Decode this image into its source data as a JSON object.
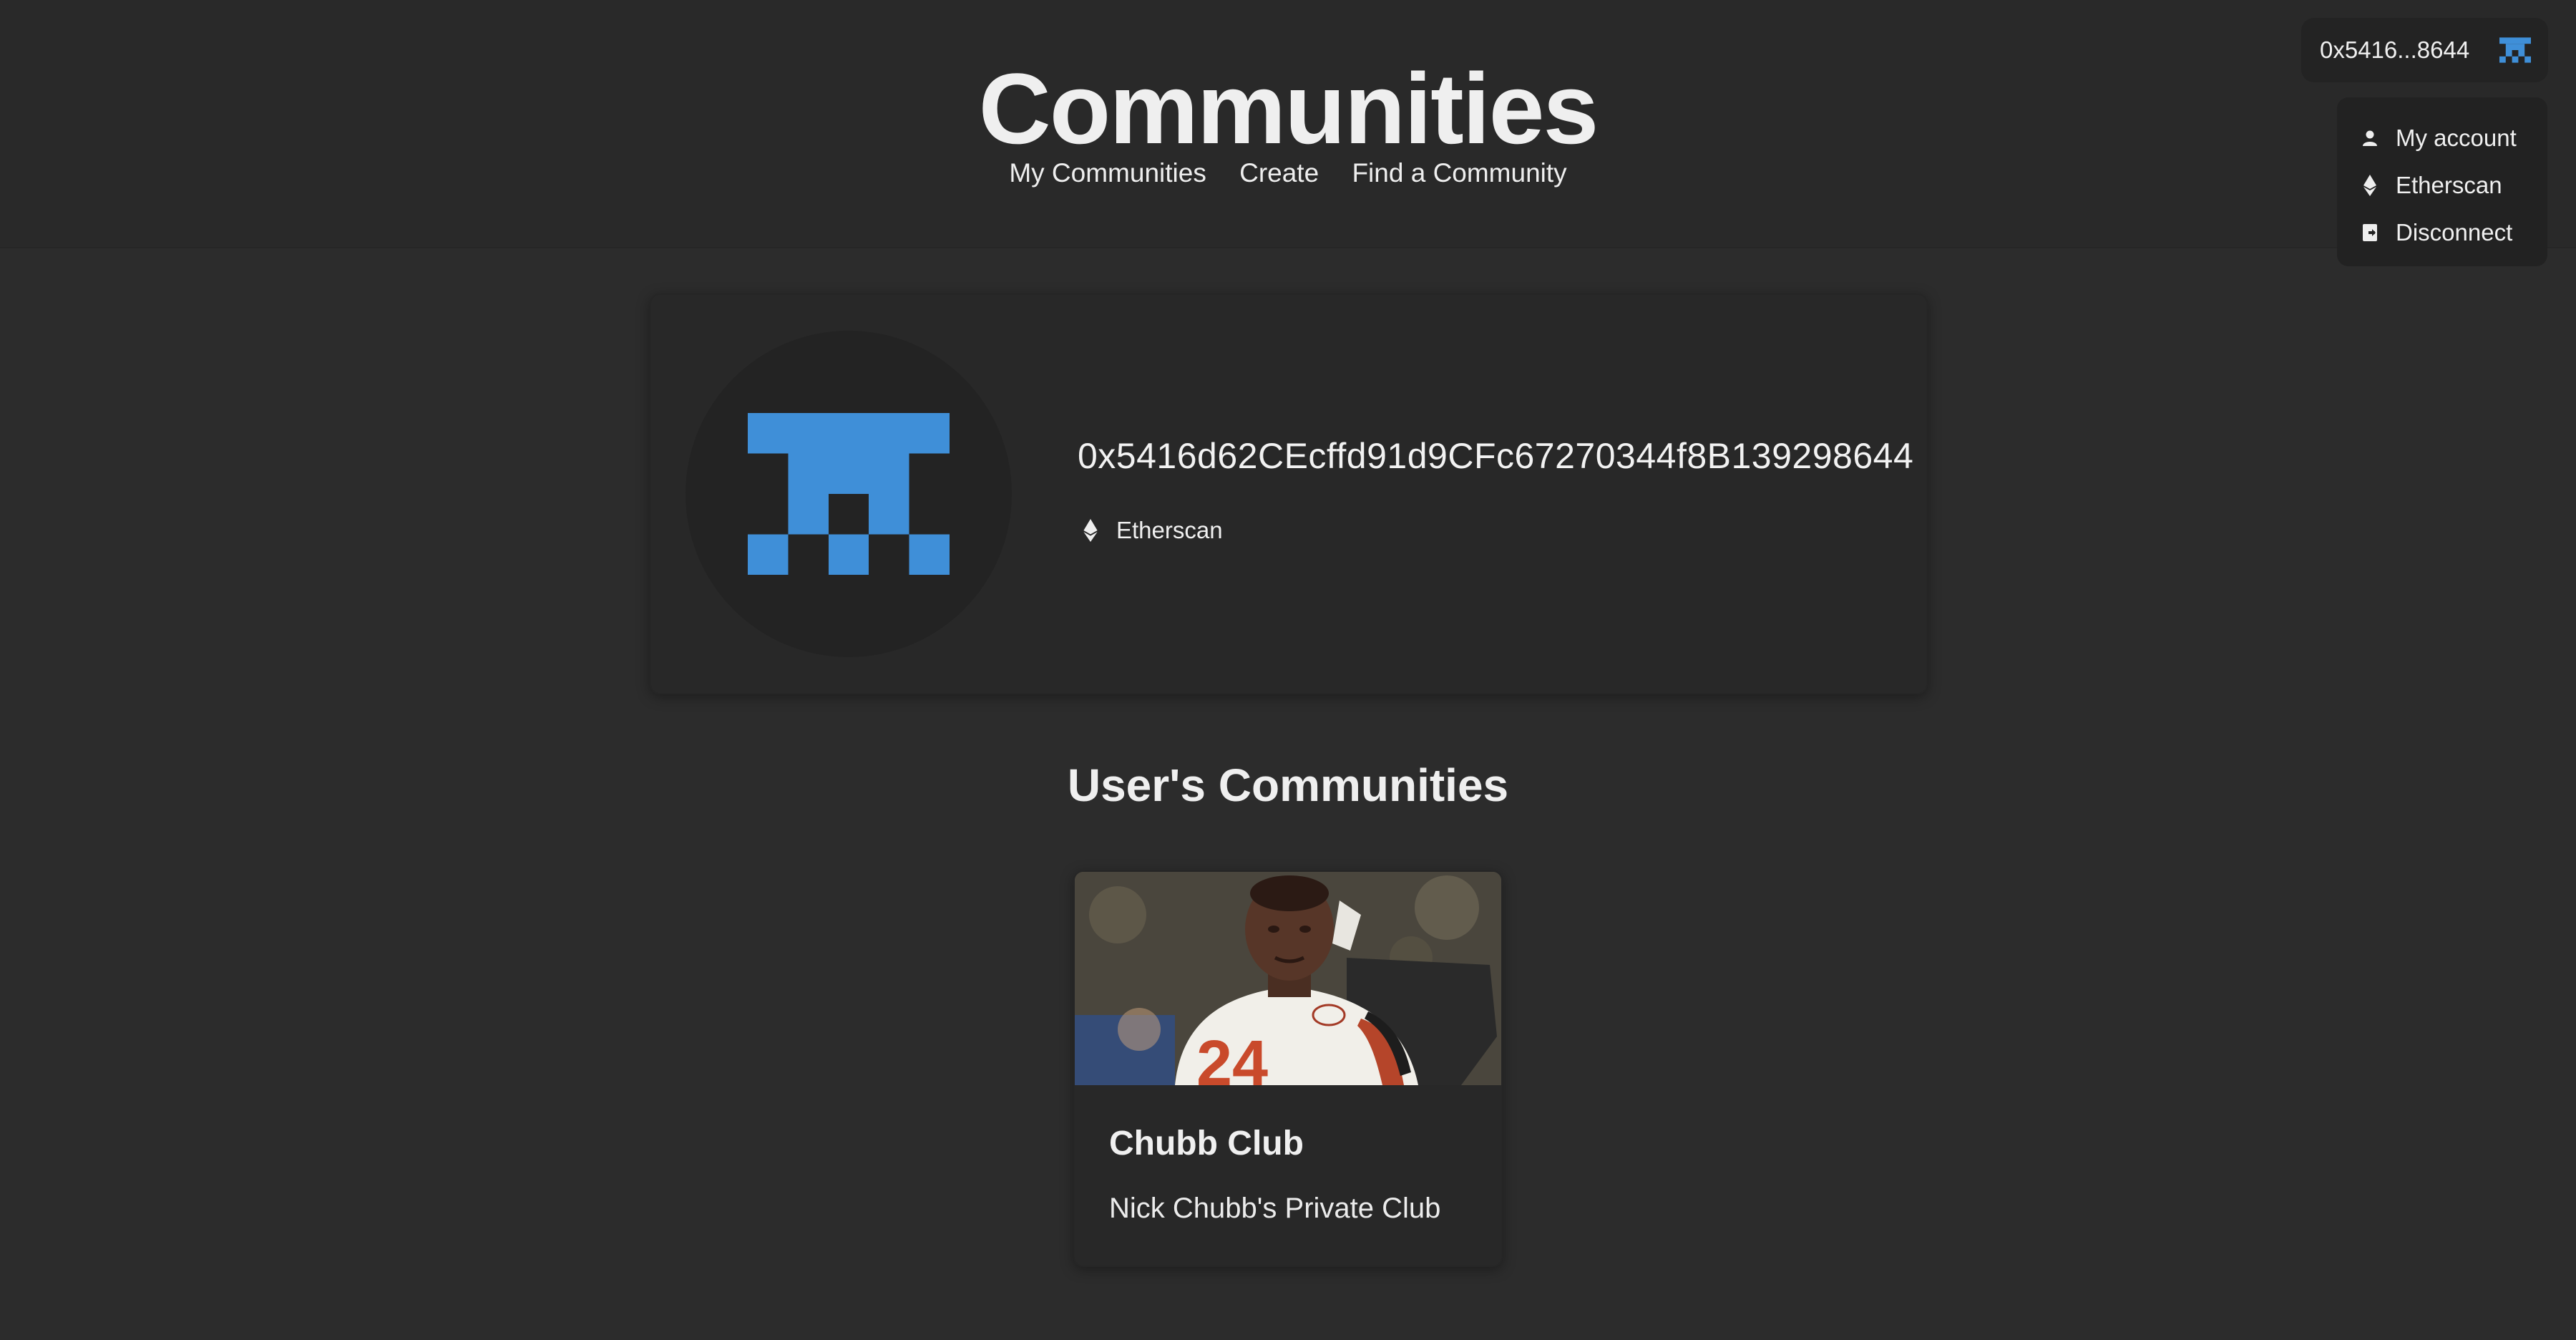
{
  "header": {
    "title": "Communities",
    "nav": [
      {
        "label": "My Communities"
      },
      {
        "label": "Create"
      },
      {
        "label": "Find a Community"
      }
    ]
  },
  "account": {
    "short_address": "0x5416...8644",
    "avatar_icon": "pixel-blockie-icon",
    "avatar_color": "#3f8fd8"
  },
  "dropdown": {
    "items": [
      {
        "label": "My account",
        "icon": "user-icon"
      },
      {
        "label": "Etherscan",
        "icon": "ethereum-icon"
      },
      {
        "label": "Disconnect",
        "icon": "logout-icon"
      }
    ]
  },
  "profile": {
    "address": "0x5416d62CEcffd91d9CFc67270344f8B139298644",
    "etherscan_label": "Etherscan"
  },
  "section": {
    "title": "User's Communities"
  },
  "communities": [
    {
      "name": "Chubb Club",
      "description": "Nick Chubb's Private Club"
    }
  ],
  "colors": {
    "background": "#2c2c2c",
    "header_bg": "#292929",
    "card_bg": "#282828",
    "accent": "#3f8fd8"
  }
}
